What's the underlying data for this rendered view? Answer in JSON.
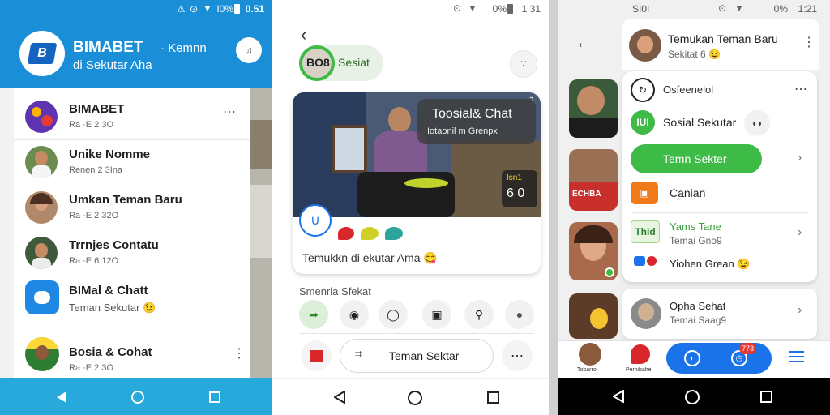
{
  "panel1": {
    "status_time": "0.51",
    "status_battery": "I0%",
    "brand_title": "BIMABET",
    "brand_title_suffix": "· Kemnn",
    "brand_subtitle": "di Sekutar Aha",
    "chats": [
      {
        "name": "BIMABET",
        "sub": "Ra ·E 2 3O"
      },
      {
        "name": "Unike Nomme",
        "sub": "Renen 2 3Ina"
      },
      {
        "name": "Umkan Teman Baru",
        "sub": "Ra ·E 2 32O"
      },
      {
        "name": "Trrnjes Contatu",
        "sub": "Ra ·E 6 12O"
      },
      {
        "name": "BIMal & Chatt",
        "sub": "Teman Sekutar 😉"
      },
      {
        "name": "Bosia & Cohat",
        "sub": "Ra ·E 2 3O"
      }
    ],
    "more_label": "⋯"
  },
  "panel2": {
    "status_time": "1 31",
    "status_battery": "0%",
    "pill_badge": "BO8",
    "pill_label": "Sesiat",
    "hero_title": "Toosial& Chat",
    "hero_subtitle": "Iotaonil m Grenpx",
    "hero_score_label": "Isn1",
    "hero_score_value": "6 0",
    "caption": "Temukkn di ekutar Ama 😋",
    "section_label": "Smenrla Sfekat",
    "compose_label": "Teman Sektar"
  },
  "panel3": {
    "status_left": "SI0I",
    "status_time": "1:21",
    "status_battery": "0%",
    "header_title": "Temukan Teman Baru",
    "header_sub": "Sekitat 6 😉",
    "card_items": {
      "item1": "Osfeenelol",
      "item2": "Sosial Sekutar",
      "cta": "Temn Sekter",
      "item3": "Canian",
      "item4_title": "Yams Tane",
      "item4_sub": "Temai Gno9",
      "item4_icon": "ThId",
      "item5": "Yiohen Grean 😉",
      "item6_title": "Opha Sehat",
      "item6_sub": "Temai Saag9"
    },
    "side_thumb_text": "ECHBA",
    "bottom_tab1": "Tobarro",
    "bottom_tab2": "Pemibahe",
    "notif_count": "773"
  },
  "colors": {
    "blue": "#1a8fd8",
    "green": "#3dbb46",
    "accent_blue": "#1a73e8",
    "nav_blue": "#27a9db"
  }
}
